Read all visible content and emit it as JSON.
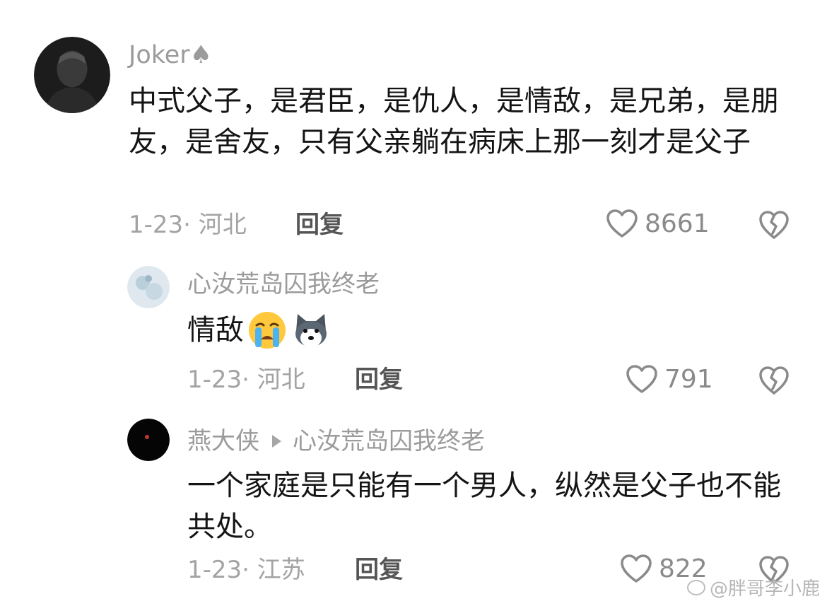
{
  "comment": {
    "username": "Joker♠",
    "text": "中式父子，是君臣，是仇人，是情敌，是兄弟，是朋友，是舍友，只有父亲躺在病床上那一刻才是父子",
    "date_location": "1-23· 河北",
    "reply_label": "回复",
    "likes": "8661"
  },
  "replies": [
    {
      "username": "心汝荒岛囚我终老",
      "text": "情敌",
      "emojis": [
        "crying-face",
        "husky-dog"
      ],
      "date_location": "1-23· 河北",
      "reply_label": "回复",
      "likes": "791"
    },
    {
      "username": "燕大侠",
      "reply_to": "心汝荒岛囚我终老",
      "text": "一个家庭是只能有一个男人，纵然是父子也不能共处。",
      "date_location": "1-23· 江苏",
      "reply_label": "回复",
      "likes": "822"
    }
  ],
  "watermark": "@胖哥李小鹿",
  "icons": {
    "like": "heart-outline-icon",
    "dislike": "broken-heart-icon"
  }
}
